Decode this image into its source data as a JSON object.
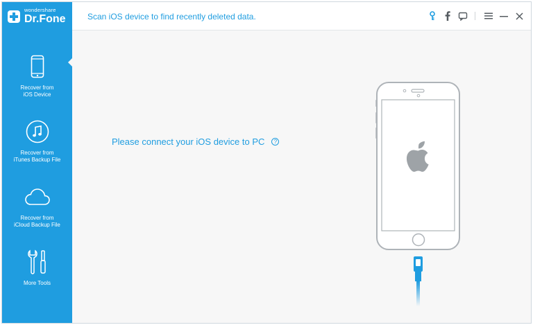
{
  "app": {
    "brand": "wondershare",
    "product": "Dr.Fone",
    "title_text": "Scan iOS device to find recently deleted data."
  },
  "toolbar": {
    "icons": [
      "key-icon",
      "facebook-icon",
      "feedback-icon",
      "menu-icon",
      "minimize-icon",
      "close-icon"
    ]
  },
  "sidebar": {
    "items": [
      {
        "label": "Recover from\niOS Device",
        "icon": "phone-icon",
        "active": true
      },
      {
        "label": "Recover from\niTunes Backup File",
        "icon": "music-note-icon",
        "active": false
      },
      {
        "label": "Recover from\niCloud Backup File",
        "icon": "cloud-icon",
        "active": false
      },
      {
        "label": "More Tools",
        "icon": "tools-icon",
        "active": false
      }
    ]
  },
  "main": {
    "prompt": "Please connect your iOS device to PC",
    "help_glyph": "?"
  },
  "colors": {
    "accent": "#1f9de0",
    "background": "#f7f7f7"
  }
}
